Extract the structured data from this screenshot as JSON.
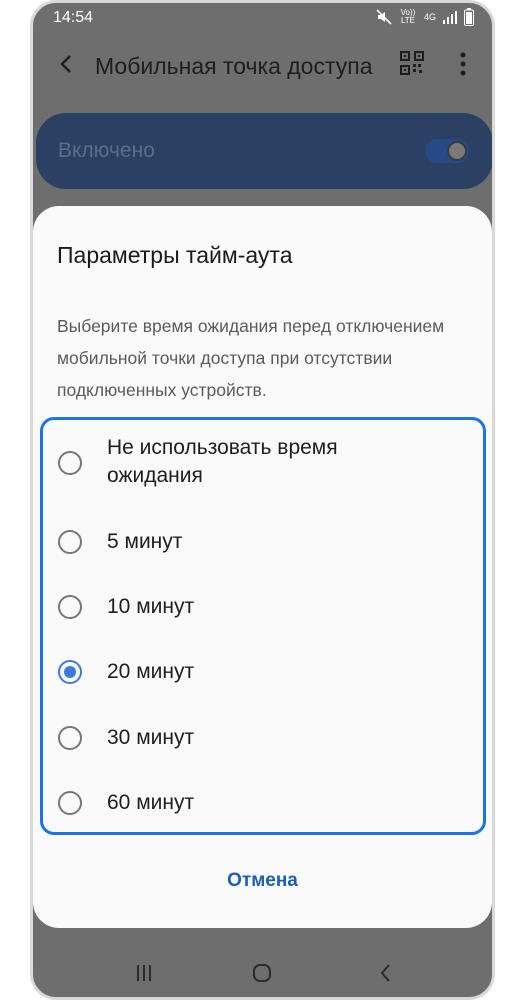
{
  "status_bar": {
    "time": "14:54",
    "volte_label": "Vo)) LTE",
    "network_label": "4G"
  },
  "app_bar": {
    "title": "Мобильная точка доступа"
  },
  "hotspot_toggle": {
    "label": "Включено",
    "on": true
  },
  "dialog": {
    "title": "Параметры тайм-аута",
    "description": "Выберите время ожидания перед отключением мобильной точки доступа при отсутствии подключенных устройств.",
    "options": [
      {
        "label": "Не использовать время ожидания",
        "selected": false
      },
      {
        "label": "5 минут",
        "selected": false
      },
      {
        "label": "10 минут",
        "selected": false
      },
      {
        "label": "20 минут",
        "selected": true
      },
      {
        "label": "30 минут",
        "selected": false
      },
      {
        "label": "60 минут",
        "selected": false
      }
    ],
    "cancel_label": "Отмена"
  },
  "colors": {
    "accent": "#1a73e8",
    "radio_checked": "#3a7ae0",
    "cancel_text": "#1a5fb5"
  }
}
